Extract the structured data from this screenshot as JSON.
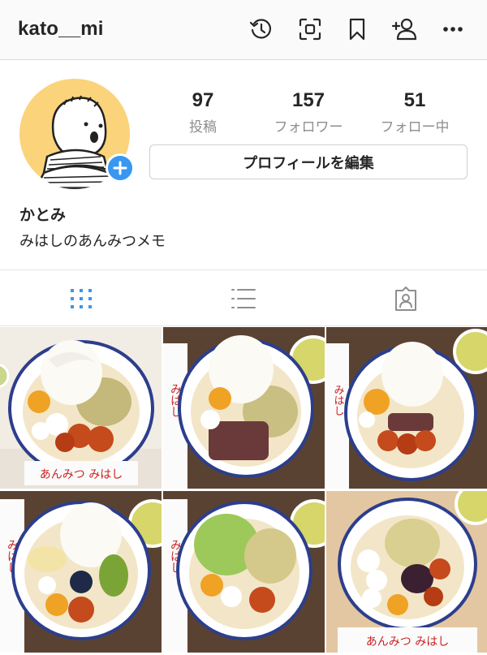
{
  "header": {
    "username": "kato__mi",
    "icons": [
      "history-icon",
      "qr-scan-icon",
      "bookmark-icon",
      "add-user-icon",
      "more-icon"
    ]
  },
  "profile": {
    "stats": {
      "posts": {
        "value": "97",
        "label": "投稿"
      },
      "followers": {
        "value": "157",
        "label": "フォロワー"
      },
      "following": {
        "value": "51",
        "label": "フォロー中"
      }
    },
    "edit_button_label": "プロフィールを編集",
    "display_name": "かとみ",
    "bio": "みはしのあんみつメモ"
  },
  "tabs": [
    {
      "icon": "grid-icon",
      "active": true
    },
    {
      "icon": "list-icon",
      "active": false
    },
    {
      "icon": "tagged-icon",
      "active": false
    }
  ],
  "colors": {
    "accent_blue": "#3897f0",
    "grid_active": "#3897f0",
    "avatar_bg": "#fbd37a",
    "muted_text": "#8e8e8e",
    "border": "#dbdbdb"
  },
  "posts": [
    {
      "type": "anmitsu-bowl",
      "toppings": [
        "soft-serve",
        "matcha-ice",
        "apricot",
        "shiratama",
        "red-bean"
      ]
    },
    {
      "type": "anmitsu-bowl",
      "toppings": [
        "soft-serve",
        "matcha-ice",
        "apricot",
        "shiratama",
        "red-bean"
      ]
    },
    {
      "type": "anmitsu-bowl",
      "toppings": [
        "soft-serve",
        "apricot",
        "shiratama",
        "red-bean"
      ]
    },
    {
      "type": "anmitsu-bowl",
      "toppings": [
        "soft-serve",
        "banana",
        "kiwi",
        "blueberry",
        "apricot"
      ]
    },
    {
      "type": "anmitsu-bowl",
      "toppings": [
        "matcha-ice",
        "hojicha-ice",
        "apricot",
        "shiratama"
      ]
    },
    {
      "type": "anmitsu-bowl",
      "toppings": [
        "hojicha-ice",
        "shiratama",
        "red-bean",
        "apricot"
      ]
    }
  ],
  "post_labels": {
    "brand": "みはし",
    "brand_prefix": "あんみつ"
  }
}
